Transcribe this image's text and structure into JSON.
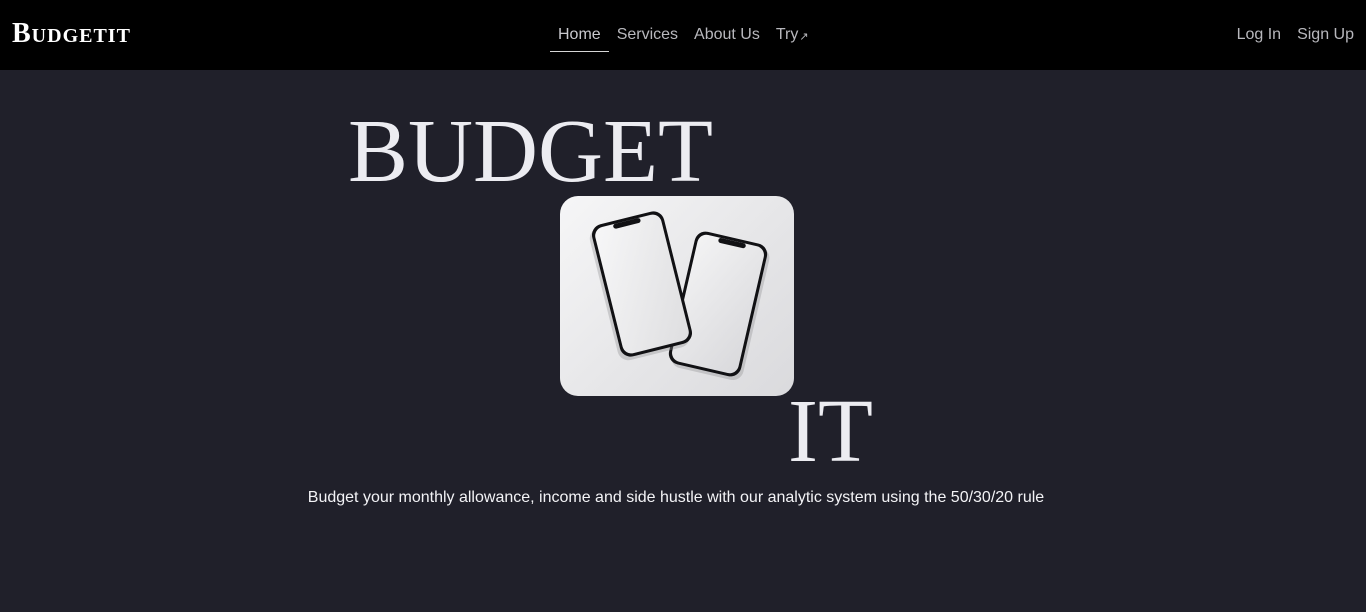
{
  "navbar": {
    "brand": "Budgetit",
    "links": [
      {
        "label": "Home",
        "active": true
      },
      {
        "label": "Services",
        "active": false
      },
      {
        "label": "About Us",
        "active": false
      },
      {
        "label": "Try",
        "active": false,
        "icon": "external-arrow-icon"
      }
    ],
    "auth": {
      "login": "Log In",
      "signup": "Sign Up"
    }
  },
  "hero": {
    "word_top": "BUDGET",
    "word_bottom": "IT",
    "image": "two-smartphones-mockup",
    "tagline": "Budget your monthly allowance, income and side hustle with our analytic system using the 50/30/20 rule"
  },
  "colors": {
    "navbar_bg": "#000000",
    "page_bg": "#20202a",
    "hero_text": "#ececf1",
    "nav_text": "#b8b8bd"
  }
}
